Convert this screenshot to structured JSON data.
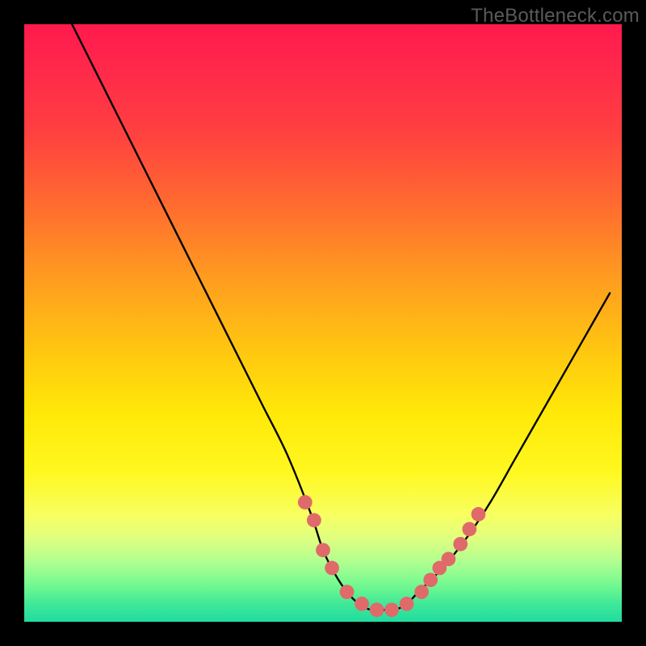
{
  "watermark": "TheBottleneck.com",
  "chart_data": {
    "type": "line",
    "title": "",
    "xlabel": "",
    "ylabel": "",
    "xlim": [
      0,
      100
    ],
    "ylim": [
      0,
      100
    ],
    "grid": false,
    "legend": false,
    "series": [
      {
        "name": "bottleneck-curve",
        "color": "#000000",
        "x": [
          8,
          12,
          16,
          20,
          24,
          28,
          32,
          36,
          40,
          44,
          48,
          50,
          52,
          54,
          56,
          58,
          60,
          62,
          64,
          66,
          70,
          74,
          78,
          82,
          86,
          90,
          94,
          98
        ],
        "y": [
          100,
          92,
          84,
          76,
          68,
          60,
          52,
          44,
          36,
          28,
          18,
          12,
          8,
          5,
          3,
          2,
          2,
          2,
          3,
          5,
          9,
          14,
          20,
          27,
          34,
          41,
          48,
          55
        ]
      }
    ],
    "markers": {
      "name": "highlight-dots",
      "color": "#e06a6a",
      "radius_pct": 1.2,
      "x": [
        47,
        48.5,
        50,
        51.5,
        54,
        56.5,
        59,
        61.5,
        64,
        66.5,
        68,
        69.5,
        71,
        73,
        74.5,
        76
      ],
      "y": [
        20,
        17,
        12,
        9,
        5,
        3,
        2,
        2,
        3,
        5,
        7,
        9,
        10.5,
        13,
        15.5,
        18
      ]
    }
  }
}
